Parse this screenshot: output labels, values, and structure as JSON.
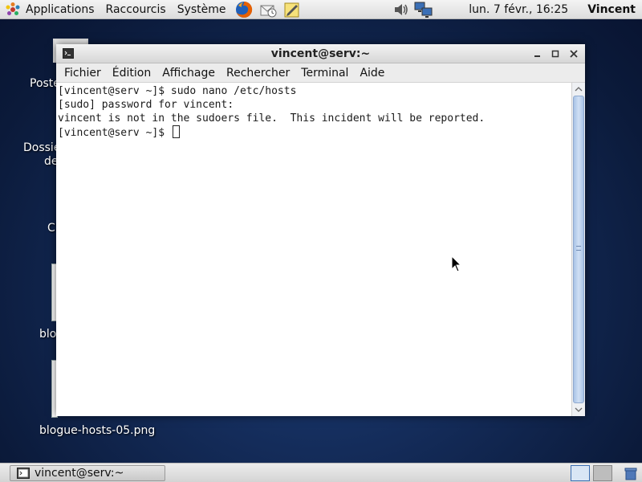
{
  "top_panel": {
    "menus": [
      "Applications",
      "Raccourcis",
      "Système"
    ],
    "launchers": [
      "firefox-icon",
      "mail-icon",
      "notes-icon"
    ],
    "tray": [
      "volume-icon",
      "network-icon"
    ],
    "clock": "lun.  7 févr., 16:25",
    "user": "Vincent"
  },
  "desktop": {
    "labels": {
      "poste": "Poste",
      "dossier": "Dossie",
      "de": "de",
      "c": "C",
      "blo": "blo",
      "png": "blogue-hosts-05.png"
    }
  },
  "terminal": {
    "title": "vincent@serv:~",
    "menus": [
      "Fichier",
      "Édition",
      "Affichage",
      "Rechercher",
      "Terminal",
      "Aide"
    ],
    "lines": [
      "[vincent@serv ~]$ sudo nano /etc/hosts",
      "[sudo] password for vincent:",
      "vincent is not in the sudoers file.  This incident will be reported.",
      "[vincent@serv ~]$ "
    ]
  },
  "bottom_panel": {
    "task": "vincent@serv:~"
  },
  "colors": {
    "desktop_bg": "#142c5a",
    "scrollbar_thumb": "#a9c3e6",
    "firefox": "#e66000"
  }
}
